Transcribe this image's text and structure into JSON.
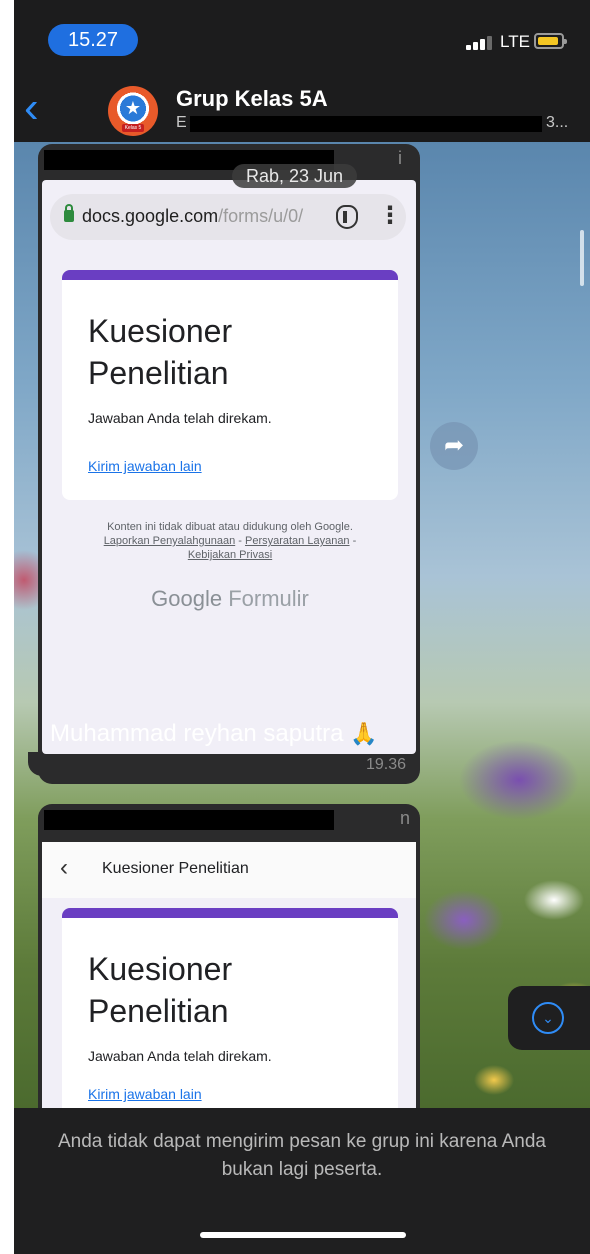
{
  "status_bar": {
    "time": "15.27",
    "network": "LTE",
    "battery_color": "#f4c623"
  },
  "header": {
    "back_icon": "chevron-left-icon",
    "title": "Grup Kelas 5A",
    "subtitle_start": "E",
    "subtitle_end": "3...",
    "avatar_label": "Kelas 5"
  },
  "messages": [
    {
      "sender_fragment": "i",
      "date_chip": "Rab, 23 Jun",
      "screenshot": {
        "url_domain": "docs.google.com",
        "url_path": "/forms/u/0/",
        "form_title": "Kuesioner Penelitian",
        "response_text": "Jawaban Anda telah direkam.",
        "link_text": "Kirim jawaban lain",
        "disclaimer": "Konten ini tidak dibuat atau didukung oleh Google.",
        "link_report": "Laporkan Penyalahgunaan",
        "link_terms": "Persyaratan Layanan",
        "link_privacy": "Kebijakan Privasi",
        "brand": "Google",
        "brand_suffix": "Formulir"
      },
      "caption": "Muhammad reyhan saputra",
      "time": "19.36"
    },
    {
      "sender_fragment": "n",
      "screenshot": {
        "app_bar_title": "Kuesioner Penelitian",
        "form_title": "Kuesioner Penelitian",
        "response_text": "Jawaban Anda telah direkam.",
        "link_text": "Kirim jawaban lain"
      }
    }
  ],
  "notice": "Anda tidak dapat mengirim pesan ke grup ini karena Anda bukan lagi peserta.",
  "colors": {
    "accent": "#2f8cf6",
    "form_accent": "#6a3ec2",
    "header_bg": "#1c1c1d",
    "time_pill": "#1f6fe0"
  }
}
